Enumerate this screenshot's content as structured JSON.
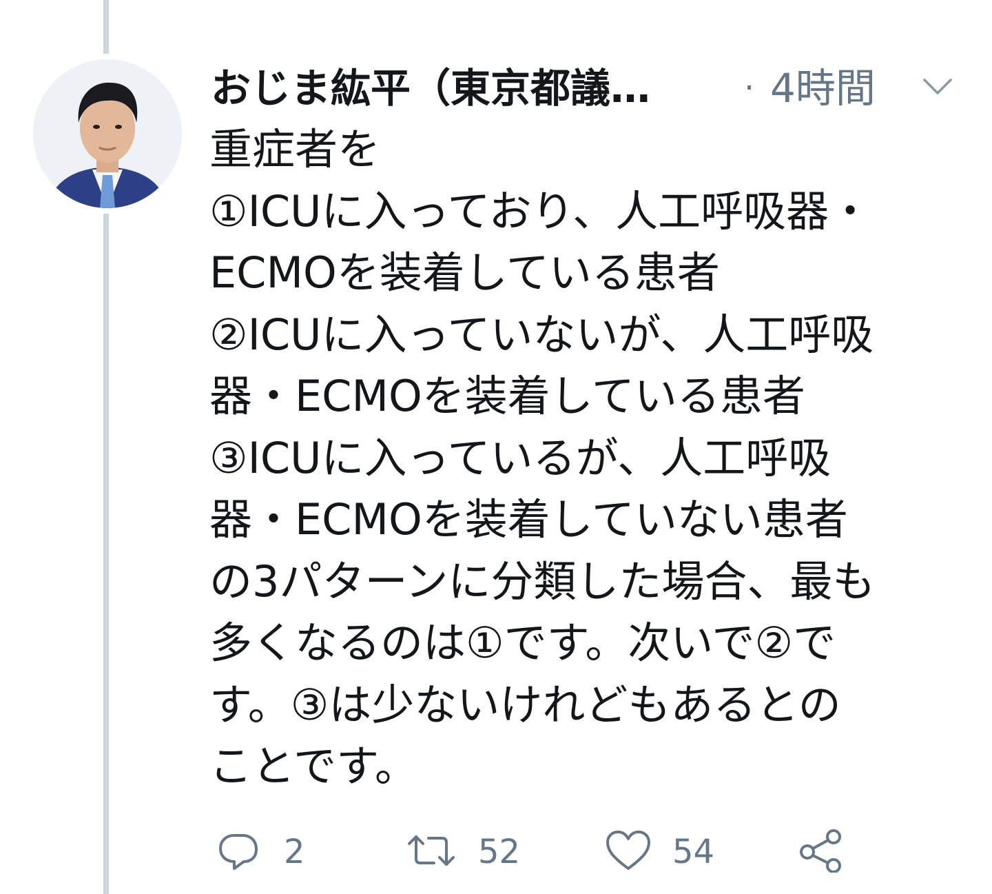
{
  "tweet": {
    "author": {
      "display_name": "おじま紘平（東京都議…"
    },
    "separator": "·",
    "timestamp": "4時間",
    "text": "重症者を\n①ICUに入っており、人工呼吸器・\nECMOを装着している患者\n②ICUに入っていないが、人工呼吸\n器・ECMOを装着している患者\n③ICUに入っているが、人工呼吸\n器・ECMOを装着していない患者\nの3パターンに分類した場合、最も\n多くなるのは①です。次いで②で\nす。③は少ないけれどもあるとの\nことです。",
    "actions": {
      "reply_count": "2",
      "retweet_count": "52",
      "like_count": "54"
    }
  },
  "icons": {
    "reply": "reply-icon",
    "retweet": "retweet-icon",
    "like": "like-icon",
    "share": "share-icon",
    "menu": "chevron-down-icon"
  },
  "colors": {
    "text_primary": "#14171a",
    "text_secondary": "#657786",
    "thread_line": "#ccd6dd",
    "background": "#ffffff"
  }
}
